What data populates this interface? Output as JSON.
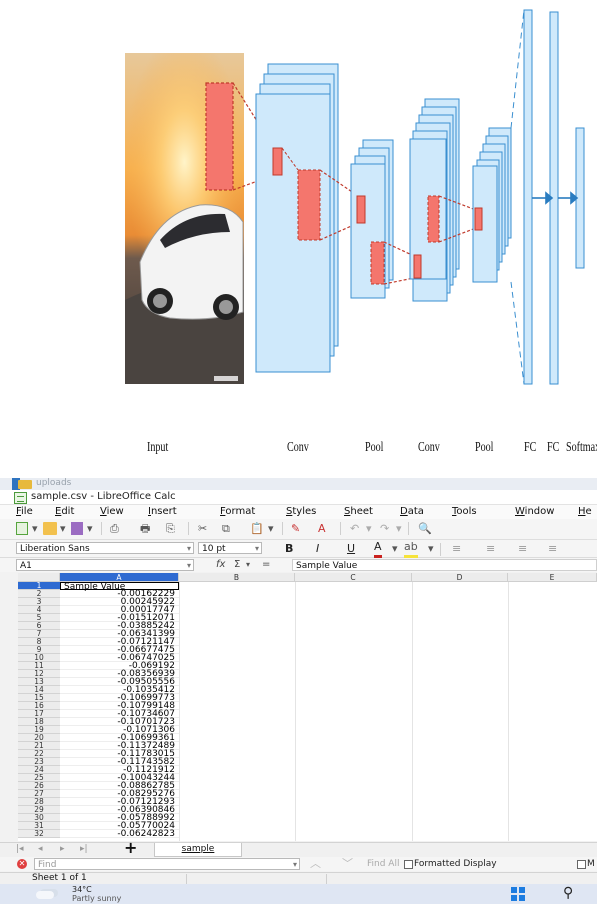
{
  "diagram": {
    "labels": [
      "Input",
      "Conv",
      "Pool",
      "Conv",
      "Pool",
      "FC",
      "FC",
      "Softmax"
    ],
    "colors": {
      "layer_fill": "#cfe9fb",
      "layer_stroke": "#3a8fd0",
      "receptive": "#f4766d",
      "receptive_stroke": "#c0392b",
      "sky": "#f3b15e"
    }
  },
  "explorer": {
    "folder_label": "uploads"
  },
  "window": {
    "title": "sample.csv - LibreOffice Calc"
  },
  "menu": [
    "File",
    "Edit",
    "View",
    "Insert",
    "Format",
    "Styles",
    "Sheet",
    "Data",
    "Tools",
    "Window",
    "He"
  ],
  "formatting": {
    "font_name": "Liberation Sans",
    "font_size": "10 pt",
    "bold": "B",
    "italic": "I",
    "underline": "U"
  },
  "formula_bar": {
    "cell_ref": "A1",
    "fx": "fx",
    "sigma": "Σ",
    "equals": "=",
    "content": "Sample Value"
  },
  "sheet": {
    "columns": [
      "A",
      "B",
      "C",
      "D",
      "E"
    ],
    "rows": [
      {
        "n": "1",
        "v": "Sample Value"
      },
      {
        "n": "2",
        "v": "-0.00162229"
      },
      {
        "n": "3",
        "v": "0.00245922"
      },
      {
        "n": "4",
        "v": "0.00017747"
      },
      {
        "n": "5",
        "v": "-0.01512071"
      },
      {
        "n": "6",
        "v": "-0.03885242"
      },
      {
        "n": "7",
        "v": "-0.06341399"
      },
      {
        "n": "8",
        "v": "-0.07121147"
      },
      {
        "n": "9",
        "v": "-0.06677475"
      },
      {
        "n": "10",
        "v": "-0.06747025"
      },
      {
        "n": "11",
        "v": "-0.069192"
      },
      {
        "n": "12",
        "v": "-0.08356939"
      },
      {
        "n": "13",
        "v": "-0.09505556"
      },
      {
        "n": "14",
        "v": "-0.1035412"
      },
      {
        "n": "15",
        "v": "-0.10699773"
      },
      {
        "n": "16",
        "v": "-0.10799148"
      },
      {
        "n": "17",
        "v": "-0.10734607"
      },
      {
        "n": "18",
        "v": "-0.10701723"
      },
      {
        "n": "19",
        "v": "-0.1071306"
      },
      {
        "n": "20",
        "v": "-0.10699361"
      },
      {
        "n": "21",
        "v": "-0.11372489"
      },
      {
        "n": "22",
        "v": "-0.11783015"
      },
      {
        "n": "23",
        "v": "-0.11743582"
      },
      {
        "n": "24",
        "v": "-0.1121912"
      },
      {
        "n": "25",
        "v": "-0.10043244"
      },
      {
        "n": "26",
        "v": "-0.08862785"
      },
      {
        "n": "27",
        "v": "-0.08295276"
      },
      {
        "n": "28",
        "v": "-0.07121293"
      },
      {
        "n": "29",
        "v": "-0.06390846"
      },
      {
        "n": "30",
        "v": "-0.05788992"
      },
      {
        "n": "31",
        "v": "-0.05770024"
      },
      {
        "n": "32",
        "v": "-0.06242823"
      }
    ]
  },
  "tabs": {
    "sheet_tab": "sample",
    "add": "+"
  },
  "find": {
    "placeholder": "Find",
    "find_all": "Find All",
    "formatted_display": "Formatted Display",
    "match": "M"
  },
  "status": {
    "sheet_info": "Sheet 1 of 1"
  },
  "taskbar": {
    "temperature": "34°C",
    "weather": "Partly sunny"
  }
}
